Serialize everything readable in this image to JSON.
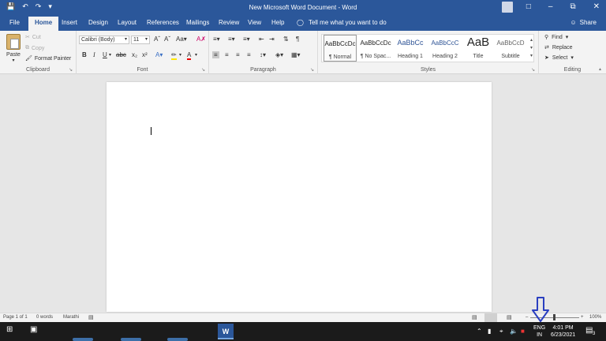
{
  "titlebar": {
    "title": "New Microsoft Word Document - Word",
    "qat": [
      "save-icon",
      "undo-icon",
      "redo-icon",
      "customize-icon"
    ],
    "controls": [
      "restore-ribbon-icon",
      "minimize-icon",
      "restore-icon",
      "close-icon"
    ]
  },
  "tabs": [
    "File",
    "Home",
    "Insert",
    "Design",
    "Layout",
    "References",
    "Mailings",
    "Review",
    "View",
    "Help"
  ],
  "active_tab": "Home",
  "tell_me": "Tell me what you want to do",
  "share": "Share",
  "clipboard": {
    "paste": "Paste",
    "cut": "Cut",
    "copy": "Copy",
    "format_painter": "Format Painter",
    "label": "Clipboard"
  },
  "font": {
    "name": "Calibri (Body)",
    "size": "11",
    "label": "Font"
  },
  "paragraph": {
    "label": "Paragraph"
  },
  "styles": {
    "label": "Styles",
    "items": [
      {
        "preview": "AaBbCcDc",
        "name": "¶ Normal"
      },
      {
        "preview": "AaBbCcDc",
        "name": "¶ No Spac..."
      },
      {
        "preview": "AaBbCc",
        "name": "Heading 1"
      },
      {
        "preview": "AaBbCcC",
        "name": "Heading 2"
      },
      {
        "preview": "AaB",
        "name": "Title"
      },
      {
        "preview": "AaBbCcD",
        "name": "Subtitle"
      }
    ]
  },
  "editing": {
    "find": "Find",
    "replace": "Replace",
    "select": "Select",
    "label": "Editing"
  },
  "status": {
    "page": "Page 1 of 1",
    "words": "0 words",
    "language": "Marathi",
    "zoom": "100%"
  },
  "taskbar": {
    "lang_line1": "ENG",
    "lang_line2": "IN",
    "time": "4:01 PM",
    "date": "6/23/2021",
    "notifications": "3",
    "word_app": "W"
  },
  "colors": {
    "word_blue": "#2b579a",
    "annotation_arrow": "#2a3fc0"
  }
}
